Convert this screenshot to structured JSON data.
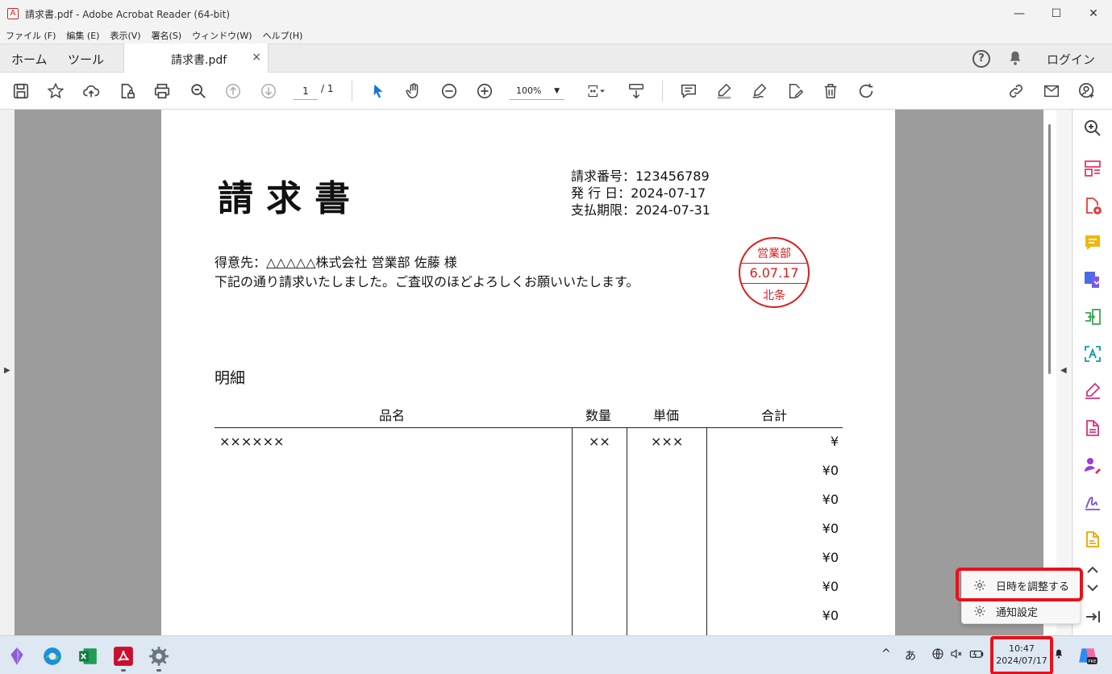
{
  "window": {
    "title": "請求書.pdf - Adobe Acrobat Reader (64-bit)",
    "minimize": "—",
    "maximize": "☐",
    "close": "✕"
  },
  "menu": [
    "ファイル (F)",
    "編集 (E)",
    "表示(V)",
    "署名(S)",
    "ウィンドウ(W)",
    "ヘルプ(H)"
  ],
  "tabs": {
    "home": "ホーム",
    "tools": "ツール",
    "document": "請求書.pdf",
    "close": "×",
    "help": "?",
    "login": "ログイン"
  },
  "toolbar": {
    "page_current": "1",
    "page_total": "/ 1",
    "zoom": "100%",
    "zoom_caret": "▼"
  },
  "document": {
    "title": "請求書",
    "invoice_number": "請求番号：123456789",
    "issue_date": "発 行 日：2024-07-17",
    "due_date": "支払期限：2024-07-31",
    "customer": "得意先：△△△△△株式会社 営業部 佐藤 様",
    "message": "下記の通り請求いたしました。ご査収のほどよろしくお願いいたします。",
    "stamp": {
      "top": "営業部",
      "middle": "6.07.17",
      "bottom": "北条",
      "color": "#d81e1e"
    },
    "section": "明細",
    "table": {
      "headers": [
        "品名",
        "数量",
        "単価",
        "合計"
      ],
      "first_row": [
        "××××××",
        "××",
        "×××",
        "¥"
      ],
      "totals": [
        "¥0",
        "¥0",
        "¥0",
        "¥0",
        "¥0",
        "¥0"
      ]
    }
  },
  "popup": {
    "adjust_datetime": "日時を調整する",
    "notification_settings": "通知設定"
  },
  "taskbar": {
    "chevron": "^",
    "ime": "あ",
    "time": "10:47",
    "date": "2024/07/17"
  },
  "colors": {
    "accent_red": "#e8111a",
    "acrobat_red": "#d0201f",
    "select_blue": "#1473e6"
  }
}
